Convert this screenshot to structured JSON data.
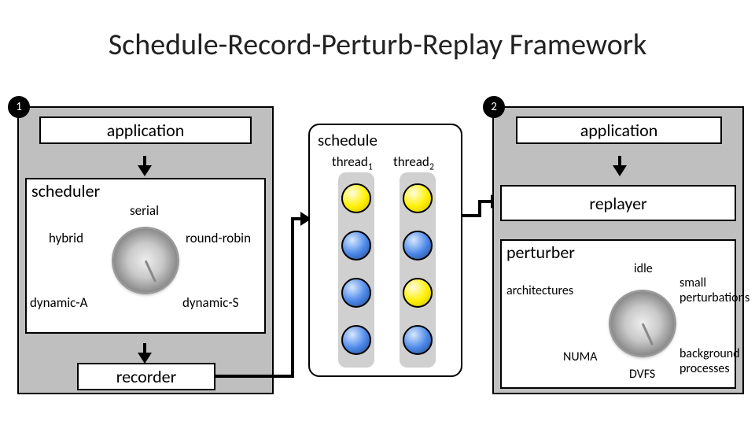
{
  "title": "Schedule-Record-Perturb-Replay Framework",
  "badges": {
    "left": "1",
    "right": "2"
  },
  "left_panel": {
    "application": "application",
    "scheduler_label": "scheduler",
    "recorder": "recorder",
    "dial_labels": {
      "serial": "serial",
      "hybrid": "hybrid",
      "round_robin": "round-robin",
      "dynamic_a": "dynamic-A",
      "dynamic_s": "dynamic-S"
    }
  },
  "schedule_box": {
    "title": "schedule",
    "thread1_prefix": "thread",
    "thread1_sub": "1",
    "thread2_prefix": "thread",
    "thread2_sub": "2"
  },
  "right_panel": {
    "application": "application",
    "replayer": "replayer",
    "perturber_label": "perturber",
    "dial_labels": {
      "idle": "idle",
      "architectures": "architectures",
      "small_perturbations": "small perturbations",
      "numa": "NUMA",
      "dvfs": "DVFS",
      "background_processes": "background processes"
    }
  },
  "chart_data": {
    "type": "other",
    "description": "Framework diagram with two panels and a central schedule",
    "schedule": {
      "thread1": [
        "yellow",
        "blue",
        "blue",
        "blue"
      ],
      "thread2": [
        "yellow",
        "blue",
        "yellow",
        "blue"
      ]
    },
    "scheduler_modes": [
      "serial",
      "hybrid",
      "round-robin",
      "dynamic-A",
      "dynamic-S"
    ],
    "perturber_modes": [
      "idle",
      "architectures",
      "small perturbations",
      "NUMA",
      "DVFS",
      "background processes"
    ]
  }
}
